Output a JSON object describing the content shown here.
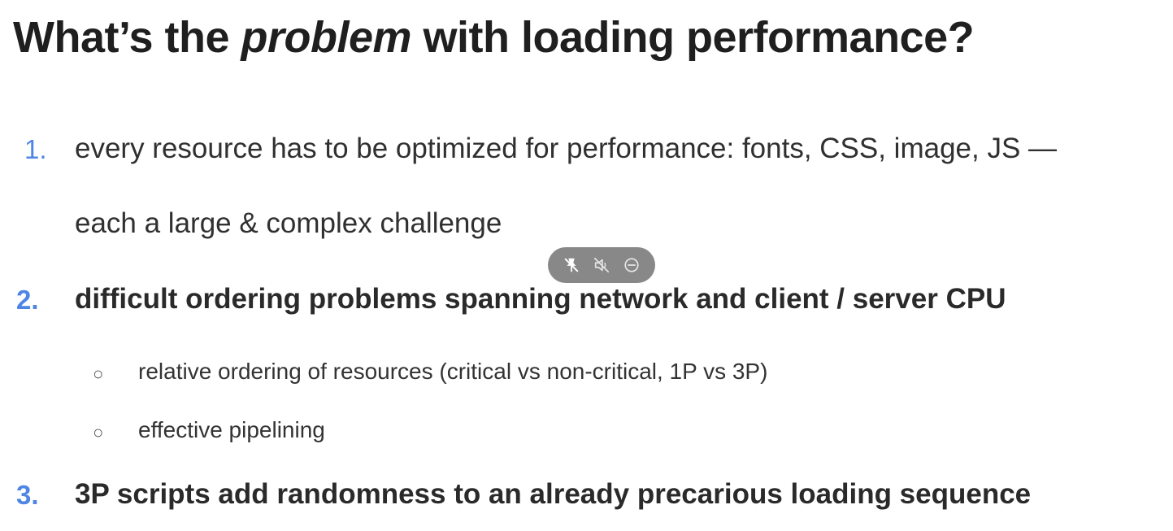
{
  "title": {
    "before": "What’s the ",
    "emphasis": "problem",
    "after": " with loading performance?"
  },
  "items": [
    {
      "number": "1.",
      "line1": "every resource has to be optimized for performance: fonts, CSS, image, JS —",
      "line2": "each a large & complex challenge"
    },
    {
      "number": "2.",
      "text": "difficult ordering problems spanning network and client / server CPU",
      "subitems": [
        {
          "bullet": "○",
          "text": "relative ordering of resources (critical vs non-critical, 1P vs 3P)"
        },
        {
          "bullet": "○",
          "text": "effective pipelining"
        }
      ]
    },
    {
      "number": "3.",
      "text": "3P scripts add randomness to an already precarious loading sequence"
    }
  ],
  "media_controls": {
    "icons": [
      "pin-off-icon",
      "mute-icon",
      "minimize-icon"
    ]
  },
  "colors": {
    "number_accent": "#4f86e6",
    "text": "#303030",
    "pill_background": "#6e6e6e"
  }
}
